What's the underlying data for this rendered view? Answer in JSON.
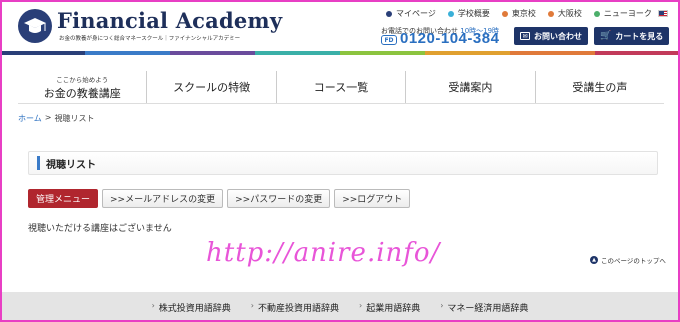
{
  "header": {
    "logo_title": "Financial Academy",
    "logo_sub": "お金の教養が身につく総合マネースクール｜ファイナンシャルアカデミー",
    "toplinks": [
      {
        "label": "マイページ",
        "color": "#2a3f78"
      },
      {
        "label": "学校概要",
        "color": "#3ab0d8"
      },
      {
        "label": "東京校",
        "color": "#e07a3a"
      },
      {
        "label": "大阪校",
        "color": "#e07a3a"
      },
      {
        "label": "ニューヨーク",
        "color": "#4caf6a"
      }
    ],
    "phone_label": "お電話でのお問い合わせ",
    "phone_hours": "10時～19時",
    "phone_number": "0120-104-384",
    "phone_icon": "FD",
    "contact_button": "お問い合わせ",
    "cart_button": "カートを見る"
  },
  "colorbar": [
    "#2a3f78",
    "#3a7bc8",
    "#6a4c9c",
    "#3ab0a8",
    "#8cc43f",
    "#e0a030",
    "#e07a3a",
    "#c23a5a"
  ],
  "nav": {
    "items": [
      {
        "small": "ここから始めよう",
        "label": "お金の教養講座"
      },
      {
        "small": "",
        "label": "スクールの特徴"
      },
      {
        "small": "",
        "label": "コース一覧"
      },
      {
        "small": "",
        "label": "受講案内"
      },
      {
        "small": "",
        "label": "受講生の声"
      }
    ]
  },
  "breadcrumb": {
    "home": "ホーム",
    "separator": ">",
    "current": "視聴リスト"
  },
  "main": {
    "title": "視聴リスト",
    "tabs": [
      {
        "label": "管理メニュー",
        "active": true
      },
      {
        "label": ">>メールアドレスの変更",
        "active": false
      },
      {
        "label": ">>パスワードの変更",
        "active": false
      },
      {
        "label": ">>ログアウト",
        "active": false
      }
    ],
    "notice": "視聴いただける講座はございません",
    "watermark": "http://anire.info/",
    "pagetop": "このページのトップへ"
  },
  "footer": {
    "links": [
      "株式投資用語辞典",
      "不動産投資用語辞典",
      "起業用語辞典",
      "マネー経済用語辞典"
    ]
  }
}
